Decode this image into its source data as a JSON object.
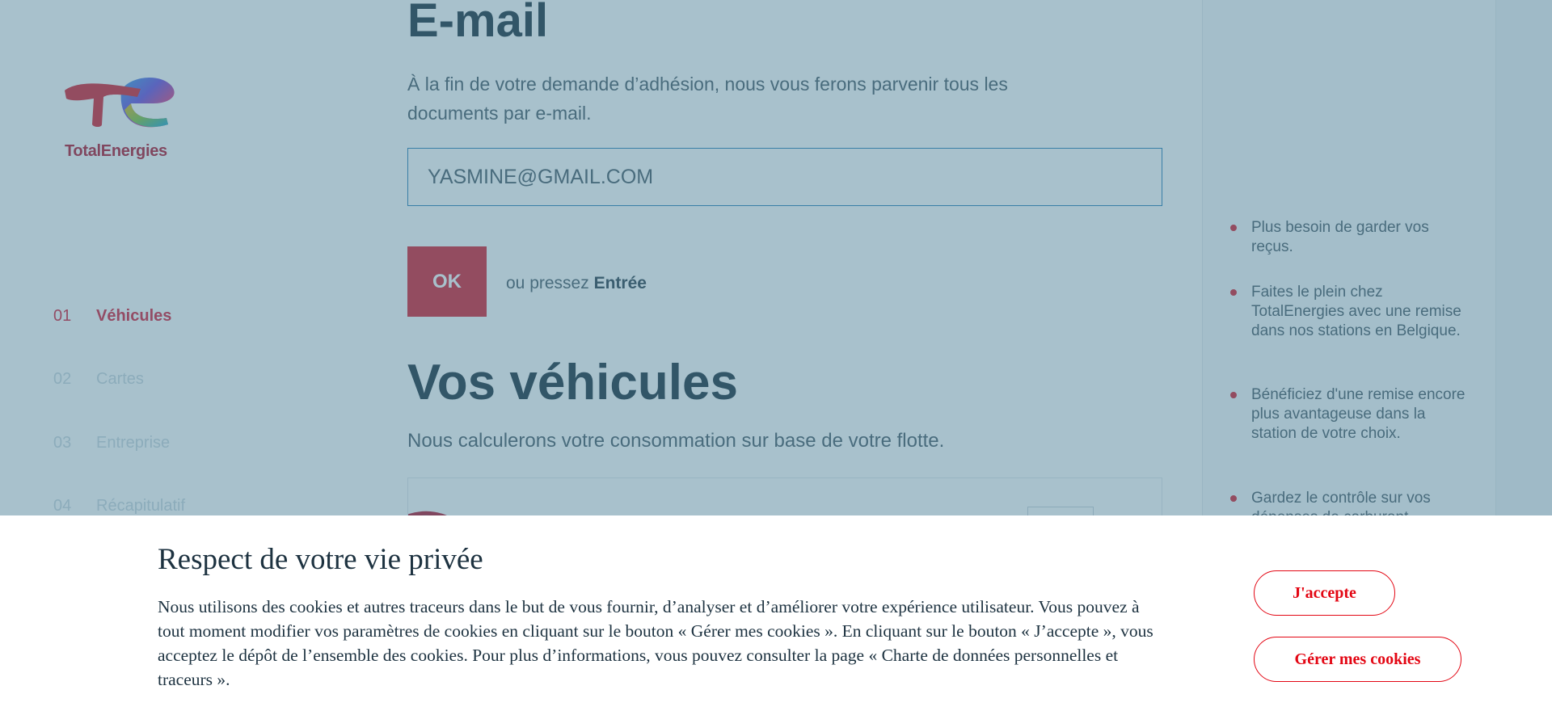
{
  "brand": {
    "name": "TotalEnergies",
    "color": "#b3162f"
  },
  "sidebar": {
    "steps": [
      {
        "number": "01",
        "label": "Véhicules",
        "active": true
      },
      {
        "number": "02",
        "label": "Cartes",
        "active": false
      },
      {
        "number": "03",
        "label": "Entreprise",
        "active": false
      },
      {
        "number": "04",
        "label": "Récapitulatif",
        "active": false
      }
    ]
  },
  "email_section": {
    "title": "E-mail",
    "description": "À la fin de votre demande d’adhésion, nous vous ferons parvenir tous les documents par e-mail.",
    "input_value": "YASMINE@GMAIL.COM",
    "ok_label": "OK",
    "hint_prefix": "ou pressez",
    "hint_key": "Entrée"
  },
  "vehicles_section": {
    "title": "Vos véhicules",
    "description": "Nous calculerons votre consommation sur base de votre flotte."
  },
  "benefits": [
    "Plus besoin de garder vos reçus.",
    "Faites le plein chez TotalEnergies avec une remise dans nos stations en Belgique.",
    "Bénéficiez d'une remise encore plus avantageuse dans la station de votre choix.",
    "Gardez le contrôle sur vos dépenses de carburant"
  ],
  "cookie_banner": {
    "title": "Respect de votre vie privée",
    "text": "Nous utilisons des cookies et autres traceurs dans le but de vous fournir, d’analyser et d’améliorer votre expérience utilisateur. Vous pouvez à tout moment modifier vos paramètres de cookies en cliquant sur le bouton « Gérer mes cookies ». En cliquant sur le bouton « J’accepte », vous acceptez le dépôt de l’ensemble des cookies. Pour plus d’informations, vous pouvez consulter la page « Charte de données personnelles et traceurs ».",
    "accept_label": "J'accepte",
    "manage_label": "Gérer mes cookies"
  },
  "colors": {
    "accent": "#d62031",
    "cookie_accent": "#e30613",
    "overlay": "#497d94"
  }
}
